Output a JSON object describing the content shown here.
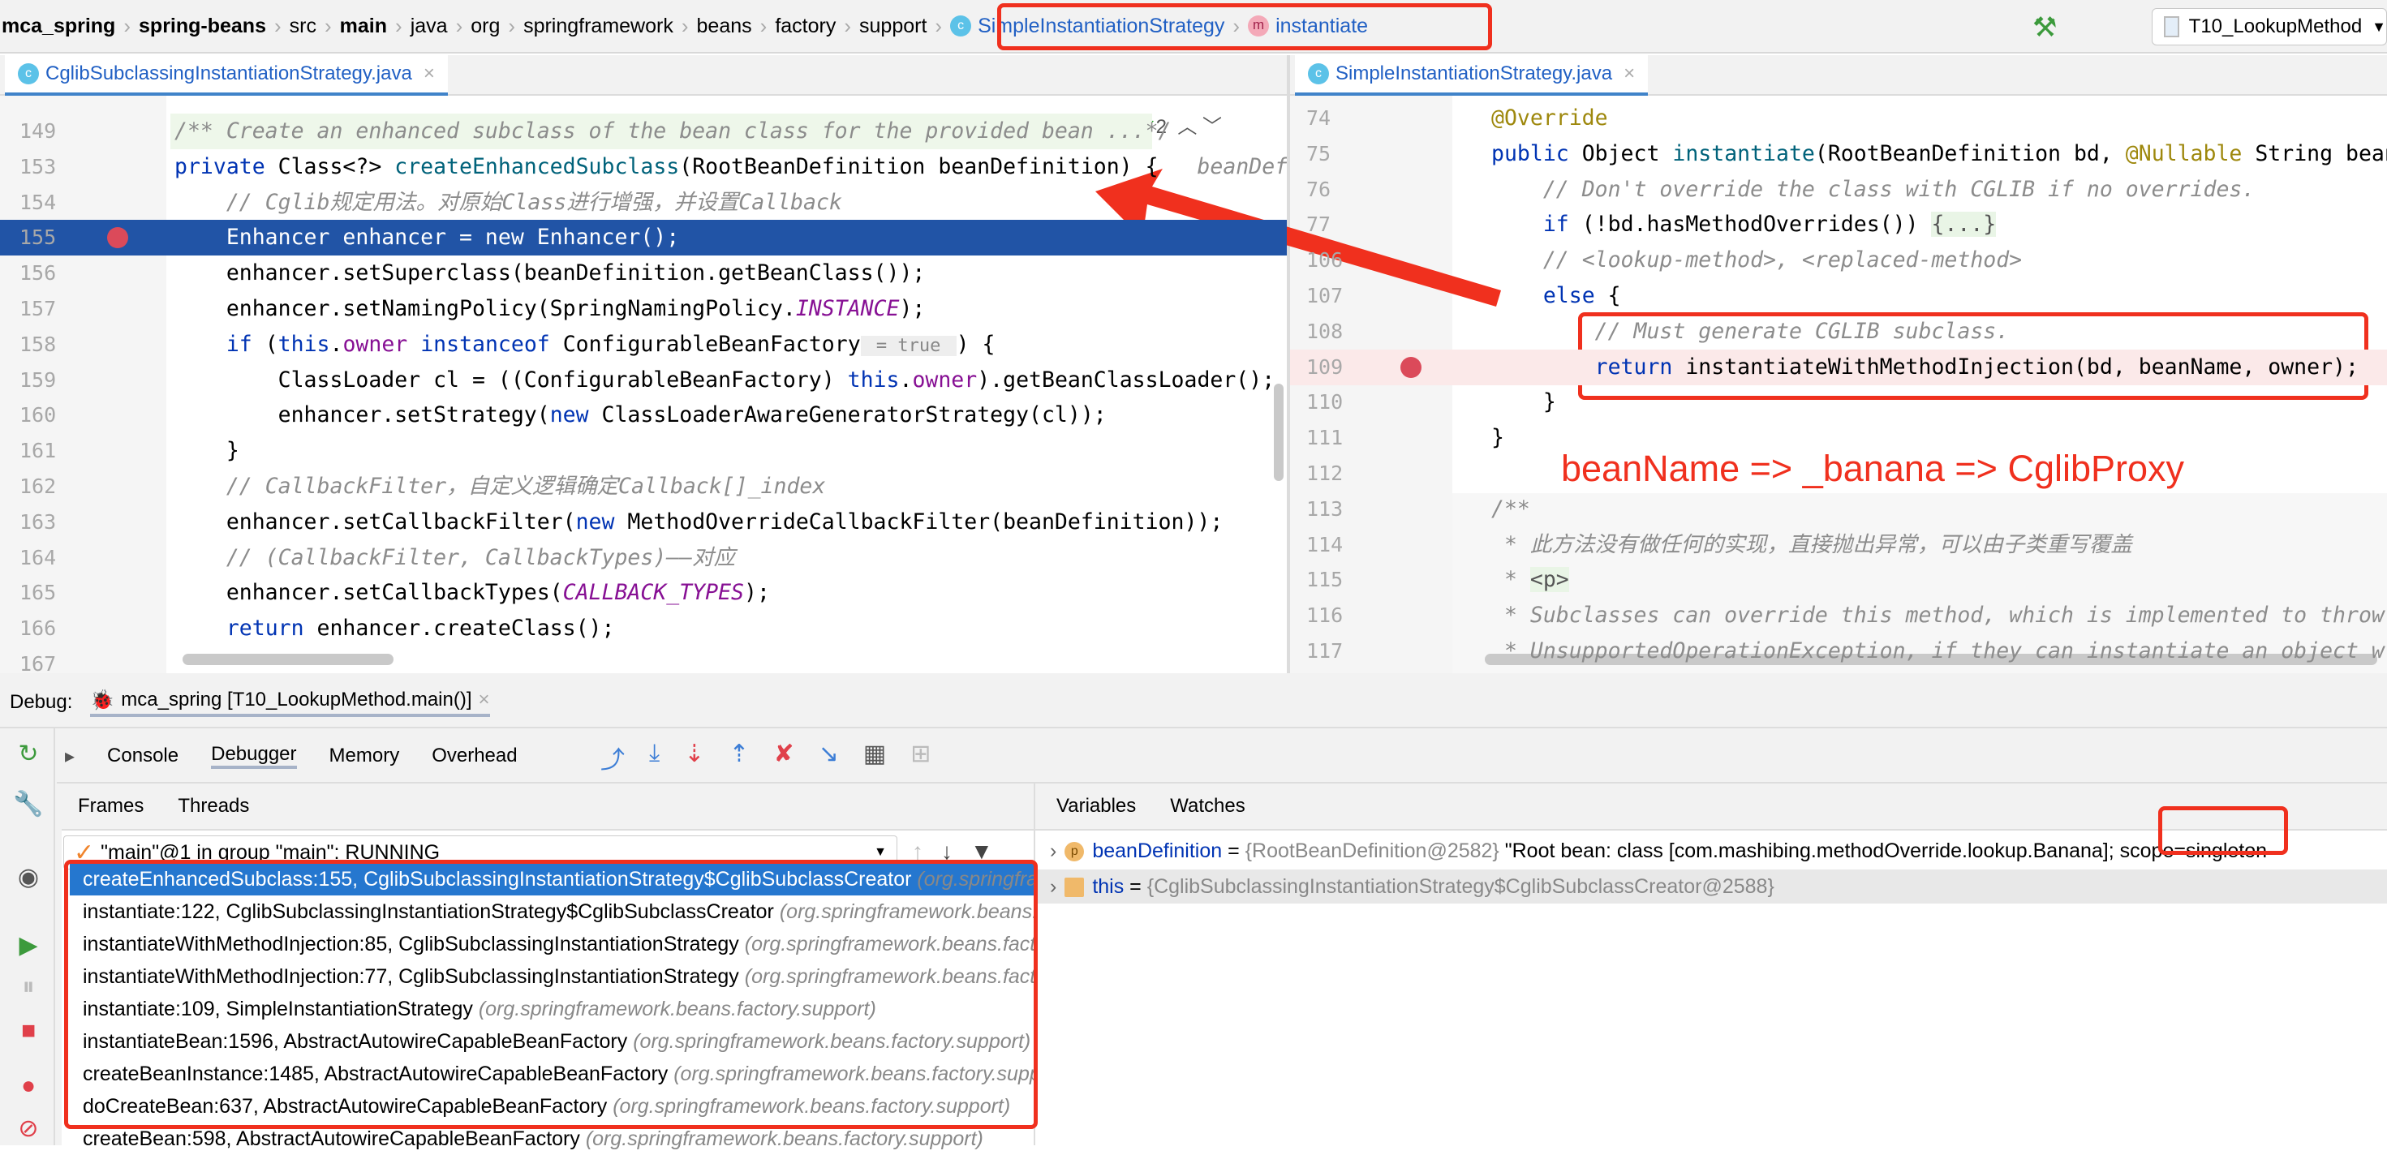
{
  "breadcrumb": [
    {
      "label": "mca_spring",
      "bold": true
    },
    {
      "label": "spring-beans",
      "bold": true
    },
    {
      "label": "src"
    },
    {
      "label": "main",
      "bold": true
    },
    {
      "label": "java"
    },
    {
      "label": "org"
    },
    {
      "label": "springframework"
    },
    {
      "label": "beans"
    },
    {
      "label": "factory"
    },
    {
      "label": "support"
    }
  ],
  "breadcrumb_class": "SimpleInstantiationStrategy",
  "breadcrumb_method": "instantiate",
  "run_config": "T10_LookupMethod",
  "left_tab": "CglibSubclassingInstantiationStrategy.java",
  "right_tab": "SimpleInstantiationStrategy.java",
  "close_glyph": "×",
  "left_lines": [
    {
      "n": "149",
      "doc": true,
      "t": [
        [
          "/** Create an enhanced subclass of the bean class for the provided bean ...*/",
          "cm"
        ]
      ]
    },
    {
      "n": "153",
      "t": [
        [
          "private ",
          "kw"
        ],
        [
          "Class<?> "
        ],
        [
          "createEnhancedSubclass",
          "fn"
        ],
        [
          "(RootBeanDefinition beanDefinition) {   "
        ],
        [
          "beanDefi",
          "cm"
        ]
      ]
    },
    {
      "n": "154",
      "t": [
        [
          "    "
        ],
        [
          "// Cglib规定用法。对原始Class进行增强，并设置Callback",
          "cm"
        ]
      ]
    },
    {
      "n": "155",
      "sel": true,
      "bp": true,
      "t": [
        [
          "    Enhancer enhancer = new Enhancer();"
        ]
      ]
    },
    {
      "n": "156",
      "t": [
        [
          "    enhancer.setSuperclass(beanDefinition.getBeanClass());"
        ]
      ]
    },
    {
      "n": "157",
      "t": [
        [
          "    enhancer.setNamingPolicy(SpringNamingPolicy."
        ],
        [
          "INSTANCE",
          "cst"
        ],
        [
          ");"
        ]
      ]
    },
    {
      "n": "158",
      "t": [
        [
          "    "
        ],
        [
          "if ",
          "kw"
        ],
        [
          "("
        ],
        [
          "this",
          "kw"
        ],
        [
          "."
        ],
        [
          "owner ",
          "fld"
        ],
        [
          "instanceof ",
          "kw"
        ],
        [
          "ConfigurableBeanFactory"
        ],
        [
          " = true ",
          "hint"
        ],
        [
          ") {"
        ]
      ]
    },
    {
      "n": "159",
      "t": [
        [
          "        ClassLoader cl = ((ConfigurableBeanFactory) "
        ],
        [
          "this",
          "kw"
        ],
        [
          "."
        ],
        [
          "owner",
          "fld"
        ],
        [
          ").getBeanClassLoader();"
        ]
      ]
    },
    {
      "n": "160",
      "t": [
        [
          "        enhancer.setStrategy("
        ],
        [
          "new ",
          "kw"
        ],
        [
          "ClassLoaderAwareGeneratorStrategy(cl));"
        ]
      ]
    },
    {
      "n": "161",
      "t": [
        [
          "    }"
        ]
      ]
    },
    {
      "n": "162",
      "t": [
        [
          "    "
        ],
        [
          "// CallbackFilter，自定义逻辑确定Callback[]_index",
          "cm"
        ]
      ]
    },
    {
      "n": "163",
      "t": [
        [
          "    enhancer.setCallbackFilter("
        ],
        [
          "new ",
          "kw"
        ],
        [
          "MethodOverrideCallbackFilter(beanDefinition));"
        ]
      ]
    },
    {
      "n": "164",
      "t": [
        [
          "    "
        ],
        [
          "// (CallbackFilter, CallbackTypes)——对应",
          "cm"
        ]
      ]
    },
    {
      "n": "165",
      "t": [
        [
          "    enhancer.setCallbackTypes("
        ],
        [
          "CALLBACK_TYPES",
          "cst"
        ],
        [
          ");"
        ]
      ]
    },
    {
      "n": "166",
      "t": [
        [
          "    "
        ],
        [
          "return ",
          "kw"
        ],
        [
          "enhancer.createClass();"
        ]
      ]
    },
    {
      "n": "167",
      "t": []
    }
  ],
  "left_inspection": {
    "count": "2"
  },
  "right_lines": [
    {
      "n": "74",
      "t": [
        [
          "@Override",
          "ann"
        ]
      ]
    },
    {
      "n": "75",
      "t": [
        [
          "public ",
          "kw"
        ],
        [
          "Object "
        ],
        [
          "instantiate",
          "fn"
        ],
        [
          "(RootBeanDefinition bd, "
        ],
        [
          "@Nullable ",
          "ann"
        ],
        [
          "String beanName"
        ]
      ]
    },
    {
      "n": "76",
      "t": [
        [
          "    "
        ],
        [
          "// Don't override the class with CGLIB if no overrides.",
          "cm"
        ]
      ]
    },
    {
      "n": "77",
      "t": [
        [
          "    "
        ],
        [
          "if ",
          "kw"
        ],
        [
          "(!bd.hasMethodOverrides()) "
        ],
        [
          "{...}",
          "fold"
        ]
      ]
    },
    {
      "n": "106",
      "t": [
        [
          "    "
        ],
        [
          "// <lookup-method>, <replaced-method>",
          "cm"
        ]
      ]
    },
    {
      "n": "107",
      "t": [
        [
          "    "
        ],
        [
          "else ",
          "kw"
        ],
        [
          "{"
        ]
      ]
    },
    {
      "n": "108",
      "t": [
        [
          "        "
        ],
        [
          "// Must generate CGLIB subclass.",
          "cm"
        ]
      ]
    },
    {
      "n": "109",
      "bp": true,
      "exec": true,
      "t": [
        [
          "        "
        ],
        [
          "return ",
          "kw"
        ],
        [
          "instantiateWithMethodInjection(bd, beanName, owner);"
        ]
      ]
    },
    {
      "n": "110",
      "t": [
        [
          "    }"
        ]
      ]
    },
    {
      "n": "111",
      "t": [
        [
          "}"
        ]
      ]
    },
    {
      "n": "112",
      "t": []
    },
    {
      "n": "113",
      "t": [
        [
          "/**",
          "cm"
        ]
      ]
    },
    {
      "n": "114",
      "t": [
        [
          " * 此方法没有做任何的实现，直接抛出异常，可以由子类重写覆盖",
          "cm"
        ]
      ]
    },
    {
      "n": "115",
      "t": [
        [
          " * ",
          "cm"
        ],
        [
          "<p>",
          "fold"
        ]
      ]
    },
    {
      "n": "116",
      "t": [
        [
          " * Subclasses can override this method, which is implemented to throw",
          "cm"
        ]
      ]
    },
    {
      "n": "117",
      "t": [
        [
          " * UnsupportedOperationException, if they can instantiate an object w",
          "cm"
        ]
      ]
    }
  ],
  "annotation": "beanName => _banana => CglibProxy",
  "debug": {
    "label": "Debug:",
    "session": "mca_spring [T10_LookupMethod.main()]",
    "tabs": [
      "Console",
      "Debugger",
      "Memory",
      "Overhead"
    ],
    "frames_tabs": [
      "Frames",
      "Threads"
    ],
    "var_tabs": [
      "Variables",
      "Watches"
    ],
    "thread": "\"main\"@1 in group \"main\": RUNNING",
    "frames": [
      {
        "m": "createEnhancedSubclass:155, CglibSubclassingInstantiationStrategy$CglibSubclassCreator",
        "p": "(org.springframework.beans.factory.support)"
      },
      {
        "m": "instantiate:122, CglibSubclassingInstantiationStrategy$CglibSubclassCreator",
        "p": "(org.springframework.beans.factory.support)"
      },
      {
        "m": "instantiateWithMethodInjection:85, CglibSubclassingInstantiationStrategy",
        "p": "(org.springframework.beans.factory.support)"
      },
      {
        "m": "instantiateWithMethodInjection:77, CglibSubclassingInstantiationStrategy",
        "p": "(org.springframework.beans.factory.support)"
      },
      {
        "m": "instantiate:109, SimpleInstantiationStrategy",
        "p": "(org.springframework.beans.factory.support)"
      },
      {
        "m": "instantiateBean:1596, AbstractAutowireCapableBeanFactory",
        "p": "(org.springframework.beans.factory.support)"
      },
      {
        "m": "createBeanInstance:1485, AbstractAutowireCapableBeanFactory",
        "p": "(org.springframework.beans.factory.support)"
      },
      {
        "m": "doCreateBean:637, AbstractAutowireCapableBeanFactory",
        "p": "(org.springframework.beans.factory.support)"
      },
      {
        "m": "createBean:598, AbstractAutowireCapableBeanFactory",
        "p": "(org.springframework.beans.factory.support)"
      }
    ],
    "variables": [
      {
        "icon": "p",
        "name": "beanDefinition",
        "type": "{RootBeanDefinition@2582}",
        "value": "\"Root bean: class [com.mashibing.methodOverride.lookup.Banana]; scope=singleton"
      },
      {
        "icon": "field",
        "name": "this",
        "type": "{CglibSubclassingInstantiationStrategy$CglibSubclassCreator@2588}",
        "value": ""
      }
    ]
  },
  "colors": {
    "accent": "#2577cf",
    "highlight_red": "#f0301e",
    "selected_line": "#2154a6"
  }
}
